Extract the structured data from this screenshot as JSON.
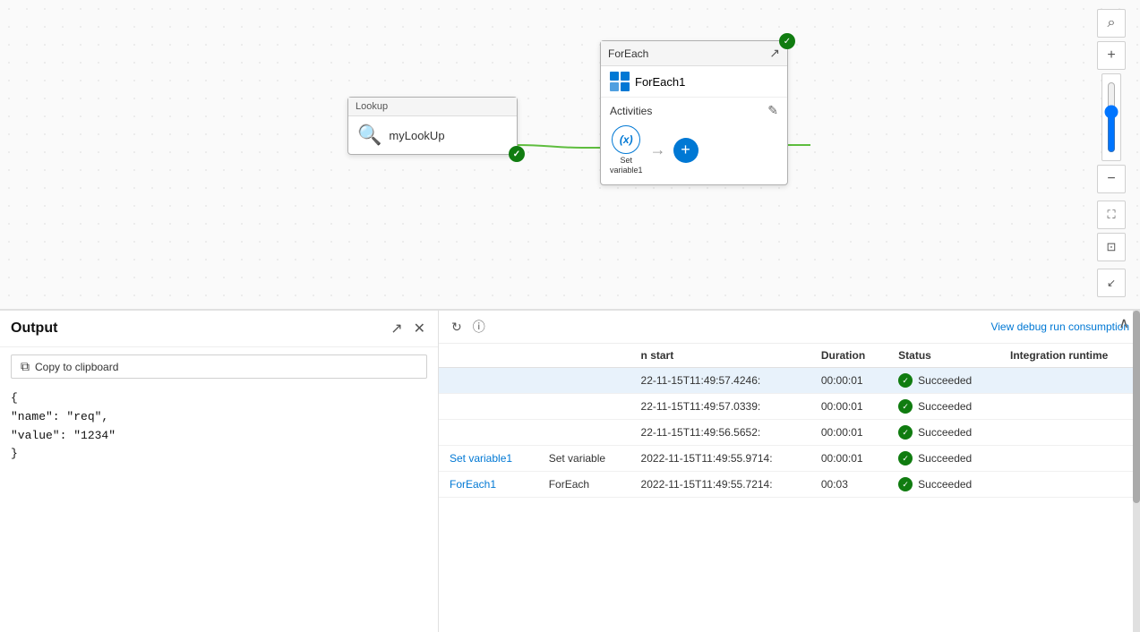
{
  "canvas": {
    "lookup_node": {
      "header": "Lookup",
      "label": "myLookUp",
      "icon": "🔍"
    },
    "foreach_node": {
      "header": "ForEach",
      "title": "ForEach1",
      "activities_label": "Activities",
      "set_variable_label": "Set\nvariable1",
      "set_variable_display": "Set\nvariable1"
    }
  },
  "output_panel": {
    "title": "Output",
    "copy_button": "Copy to clipboard",
    "content_line1": "{",
    "content_line2": "  \"name\": \"req\",",
    "content_line3": "  \"value\": \"1234\"",
    "content_line4": "}"
  },
  "run_details": {
    "view_debug_link": "View debug run consumption",
    "table": {
      "columns": [
        "",
        "n start",
        "Duration",
        "Status",
        "Integration runtime"
      ],
      "rows": [
        {
          "name": "",
          "type": "",
          "run_start": "22-11-15T11:49:57.4246:",
          "duration": "00:00:01",
          "status": "Succeeded",
          "runtime": ""
        },
        {
          "name": "",
          "type": "",
          "run_start": "22-11-15T11:49:57.0339:",
          "duration": "00:00:01",
          "status": "Succeeded",
          "runtime": ""
        },
        {
          "name": "",
          "type": "",
          "run_start": "22-11-15T11:49:56.5652:",
          "duration": "00:00:01",
          "status": "Succeeded",
          "runtime": ""
        },
        {
          "name": "Set variable1",
          "type": "Set variable",
          "run_start": "2022-11-15T11:49:55.9714:",
          "duration": "00:00:01",
          "status": "Succeeded",
          "runtime": ""
        },
        {
          "name": "ForEach1",
          "type": "ForEach",
          "run_start": "2022-11-15T11:49:55.7214:",
          "duration": "00:03",
          "status": "Succeeded",
          "runtime": ""
        }
      ]
    }
  },
  "toolbar": {
    "search_icon": "⌕",
    "zoom_in": "+",
    "zoom_out": "−",
    "fit_screen": "⛶",
    "fit_all": "⊡",
    "collapse": "↙"
  }
}
